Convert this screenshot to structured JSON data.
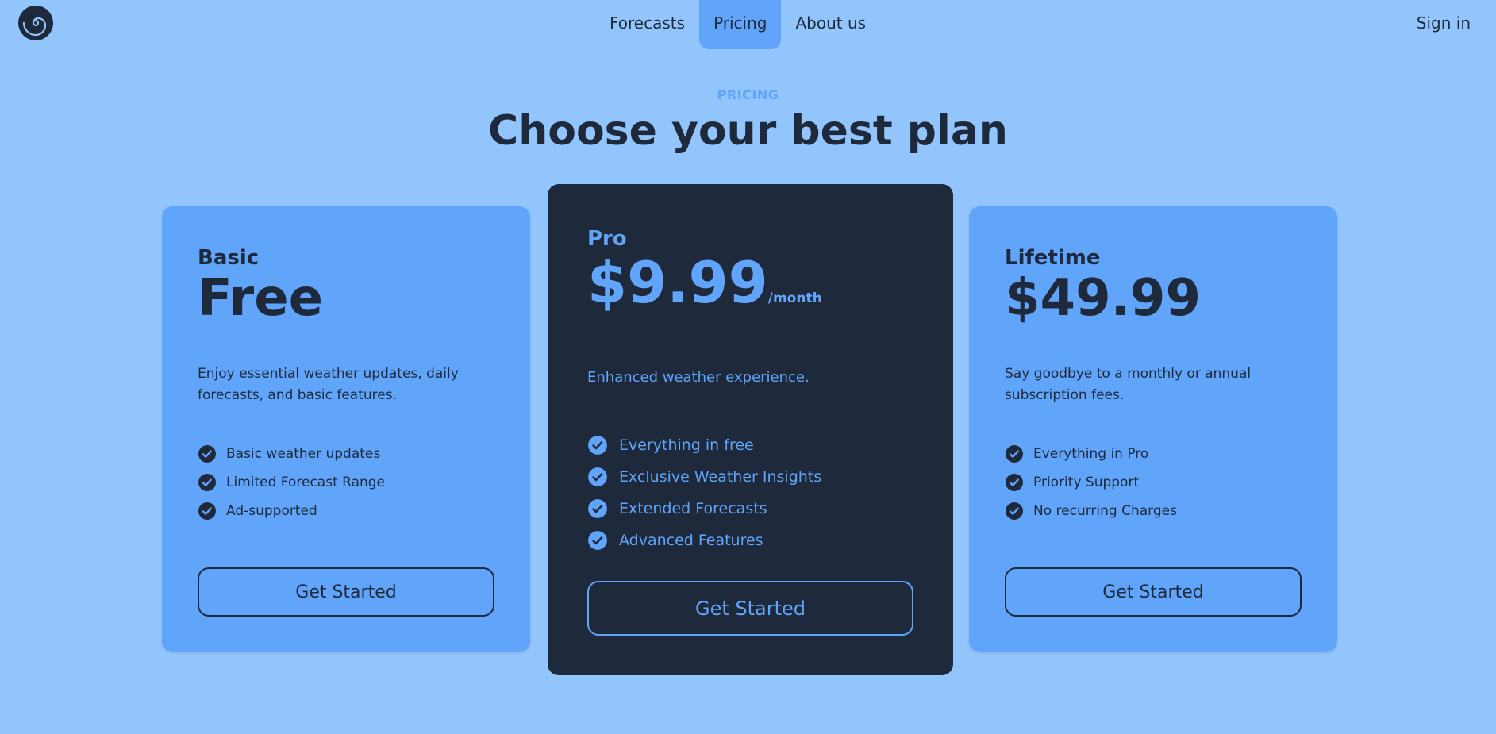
{
  "nav": {
    "links": [
      {
        "label": "Forecasts",
        "active": false
      },
      {
        "label": "Pricing",
        "active": true
      },
      {
        "label": "About us",
        "active": false
      }
    ],
    "sign_in": "Sign in",
    "logo_icon": "spiral-logo-icon"
  },
  "header": {
    "eyebrow": "PRICING",
    "title": "Choose your best plan"
  },
  "plans": [
    {
      "name": "Basic",
      "price": "Free",
      "period": "",
      "description": "Enjoy essential weather updates, daily forecasts, and basic features.",
      "features": [
        "Basic weather updates",
        "Limited Forecast Range",
        "Ad-supported"
      ],
      "cta": "Get Started"
    },
    {
      "name": "Pro",
      "price": "$9.99",
      "period": "/month",
      "description": "Enhanced weather experience.",
      "features": [
        "Everything in free",
        "Exclusive Weather Insights",
        "Extended Forecasts",
        "Advanced Features"
      ],
      "cta": "Get Started"
    },
    {
      "name": "Lifetime",
      "price": "$49.99",
      "period": "",
      "description": "Say goodbye to a monthly or annual subscription fees.",
      "features": [
        "Everything in Pro",
        "Priority Support",
        "No recurring Charges"
      ],
      "cta": "Get Started"
    }
  ],
  "colors": {
    "background": "#93c5fd",
    "accent": "#60a5fa",
    "dark": "#1e293b"
  }
}
